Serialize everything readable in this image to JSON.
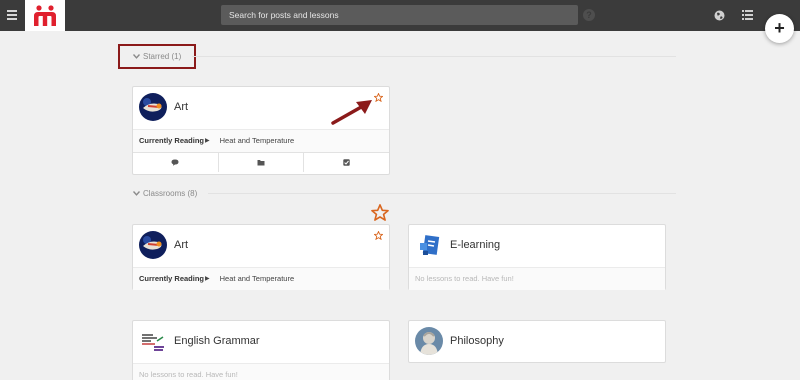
{
  "topbar": {
    "search_placeholder": "Search for posts and lessons",
    "help_glyph": "?",
    "icons": [
      "menu-icon",
      "logo-icon",
      "help-icon",
      "globe-icon",
      "list-icon"
    ]
  },
  "fab": {
    "label": "+"
  },
  "sections": {
    "starred": {
      "label": "Starred (1)"
    },
    "classrooms": {
      "label": "Classrooms (8)"
    }
  },
  "starred_cards": [
    {
      "title": "Art",
      "reading_label": "Currently Reading",
      "reading_value": "Heat and Temperature",
      "starred": true,
      "actions": [
        "comment-icon",
        "folder-icon",
        "checkbox-icon"
      ]
    }
  ],
  "classroom_cards": [
    {
      "title": "Art",
      "reading_label": "Currently Reading",
      "reading_value": "Heat and Temperature",
      "starred": true
    },
    {
      "title": "E-learning",
      "empty_text": "No lessons to read. Have fun!"
    },
    {
      "title": "English Grammar",
      "empty_text": "No lessons to read. Have fun!"
    },
    {
      "title": "Philosophy"
    }
  ],
  "colors": {
    "topbar": "#3b3b3b",
    "accent_star": "#d9661f",
    "annotation": "#8b1a1a",
    "logo": "#e0202e"
  }
}
